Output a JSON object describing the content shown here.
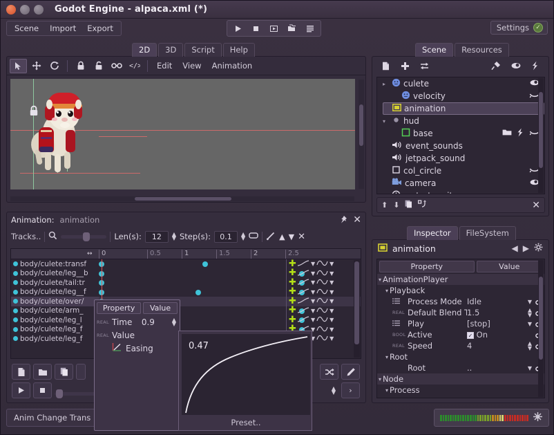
{
  "window": {
    "title": "Godot Engine - alpaca.xml (*)",
    "buttons": {
      "close": "×",
      "minimize": "–",
      "maximize": "□"
    }
  },
  "mainmenu": {
    "items": [
      "Scene",
      "Import",
      "Export"
    ]
  },
  "playbar": {
    "icons": [
      "play-icon",
      "stop-icon",
      "play-scene-icon",
      "play-custom-scene-icon",
      "list-icon"
    ]
  },
  "settings": {
    "label": "Settings",
    "badge": "✓"
  },
  "main_tabs": {
    "items": [
      "2D",
      "3D",
      "Script",
      "Help"
    ],
    "active": "2D"
  },
  "viewport_toolbar": {
    "tools": [
      "select-icon",
      "move-icon",
      "rotate-icon",
      "lock-icon",
      "unlock-icon",
      "group-icon",
      "ungroup-icon"
    ],
    "menus": [
      "Edit",
      "View",
      "Animation"
    ]
  },
  "viewport": {
    "lock_icon": "lock-icon"
  },
  "animation_panel": {
    "title_label": "Animation:",
    "animation_name": "animation",
    "tracks_label": "Tracks..",
    "len_label": "Len(s):",
    "len_value": "12",
    "step_label": "Step(s):",
    "step_value": "0.1",
    "ruler_ticks": [
      "0",
      "0.5",
      "1",
      "1.5",
      "2",
      "2.5"
    ],
    "tracks": [
      {
        "name": "body/culete:transf",
        "keys": [
          0.0,
          1.5
        ],
        "selected": false
      },
      {
        "name": "body/culete/leg__b",
        "keys": [
          0.0,
          2.9
        ],
        "selected": false
      },
      {
        "name": "body/culete/tail:tr",
        "keys": [
          0.0,
          2.9
        ],
        "selected": false
      },
      {
        "name": "body/culete/leg__f",
        "keys": [
          0.0,
          1.4,
          2.9
        ],
        "selected": false
      },
      {
        "name": "body/culete/over/",
        "keys": [
          0.0,
          2.9
        ],
        "selected": true
      },
      {
        "name": "body/culete/arm_",
        "keys": [
          0.0,
          2.9
        ],
        "selected": false
      },
      {
        "name": "body/culete/leg_l",
        "keys": [
          0.0,
          2.9
        ],
        "selected": false
      },
      {
        "name": "body/culete/leg_f",
        "keys": [
          0.0,
          2.9
        ],
        "selected": false
      },
      {
        "name": "body/culete/leg_f",
        "keys": [
          0.0,
          2.9
        ],
        "selected": false
      }
    ],
    "bottom_tools": [
      "new-animation-icon",
      "open-animation-icon",
      "duplicate-animation-icon",
      "more-icon"
    ],
    "transport": [
      "play-icon",
      "stop-icon"
    ],
    "right_tools": [
      "shuffle-icon",
      "edit-icon",
      "next-icon"
    ]
  },
  "key_popup": {
    "header": {
      "property": "Property",
      "value": "Value"
    },
    "rows": [
      {
        "type": "REAL",
        "name": "Time",
        "value": "0.9",
        "icon": "spinner-icon"
      },
      {
        "type": "REAL",
        "name": "Value",
        "value": "",
        "icon": ""
      },
      {
        "type": "",
        "name": "Easing",
        "value": "",
        "icon": "curve-icon"
      }
    ]
  },
  "easing_popup": {
    "value": "0.47",
    "preset_label": "Preset.."
  },
  "scene_dock": {
    "tabs": [
      "Scene",
      "Resources"
    ],
    "active_tab": "Scene",
    "toolbar": [
      "new-node-icon",
      "add-node-icon",
      "replace-node-icon",
      "connect-icon",
      "visibility-icon",
      "script-icon"
    ],
    "nodes": [
      {
        "label": "culete",
        "icon": "node2d-icon",
        "depth": 1,
        "arrow": "▸",
        "status": "eye-open-icon",
        "selected": false,
        "extra": []
      },
      {
        "label": "velocity",
        "icon": "node2d-icon",
        "depth": 2,
        "arrow": "",
        "status": "eye-closed-icon",
        "selected": false,
        "extra": []
      },
      {
        "label": "animation",
        "icon": "anim-icon",
        "depth": 1,
        "arrow": "",
        "status": "",
        "selected": true,
        "extra": []
      },
      {
        "label": "hud",
        "icon": "node-icon",
        "depth": 1,
        "arrow": "▾",
        "status": "",
        "selected": false,
        "extra": []
      },
      {
        "label": "base",
        "icon": "control-icon",
        "depth": 2,
        "arrow": "",
        "status": "eye-closed-icon",
        "selected": false,
        "extra": [
          "folder-icon",
          "script-icon"
        ]
      },
      {
        "label": "event_sounds",
        "icon": "sound-icon",
        "depth": 1,
        "arrow": "",
        "status": "",
        "selected": false,
        "extra": []
      },
      {
        "label": "jetpack_sound",
        "icon": "sound-icon",
        "depth": 1,
        "arrow": "",
        "status": "",
        "selected": false,
        "extra": []
      },
      {
        "label": "col_circle",
        "icon": "shape-icon",
        "depth": 1,
        "arrow": "",
        "status": "eye-closed-icon",
        "selected": false,
        "extra": []
      },
      {
        "label": "camera",
        "icon": "camera-icon",
        "depth": 1,
        "arrow": "",
        "status": "eye-open-icon",
        "selected": false,
        "extra": []
      },
      {
        "label": "restart_wait",
        "icon": "timer-icon",
        "depth": 1,
        "arrow": "",
        "status": "",
        "selected": false,
        "extra": []
      }
    ],
    "bottom_tools": [
      "move-up-icon",
      "move-down-icon",
      "duplicate-icon",
      "reparent-icon",
      "close-icon"
    ]
  },
  "inspector": {
    "tabs": [
      "Inspector",
      "FileSystem"
    ],
    "active_tab": "Inspector",
    "object_name": "animation",
    "object_icon": "anim-icon",
    "nav": [
      "back-icon",
      "forward-icon",
      "gear-icon"
    ],
    "columns": {
      "property": "Property",
      "value": "Value"
    },
    "rows": [
      {
        "kind": "category",
        "type": "",
        "name": "AnimationPlayer",
        "value": "",
        "depth": 0,
        "arrow": "▾",
        "icon": "",
        "key": false
      },
      {
        "kind": "group",
        "type": "",
        "name": "Playback",
        "value": "",
        "depth": 1,
        "arrow": "▾",
        "icon": "",
        "key": false
      },
      {
        "kind": "prop",
        "type": "",
        "name": "Process Mode",
        "value": "Idle",
        "depth": 2,
        "arrow": "",
        "icon": "enum-icon",
        "key": true,
        "ctrl": "dropdown"
      },
      {
        "kind": "prop",
        "type": "REAL",
        "name": "Default Blend Ti",
        "value": "1.5",
        "depth": 2,
        "arrow": "",
        "icon": "",
        "key": true,
        "ctrl": "spinner"
      },
      {
        "kind": "prop",
        "type": "",
        "name": "Play",
        "value": "[stop]",
        "depth": 2,
        "arrow": "",
        "icon": "enum-icon",
        "key": true,
        "ctrl": "dropdown"
      },
      {
        "kind": "prop",
        "type": "BOOL",
        "name": "Active",
        "value": "On",
        "depth": 2,
        "arrow": "",
        "icon": "",
        "key": true,
        "ctrl": "checkbox"
      },
      {
        "kind": "prop",
        "type": "REAL",
        "name": "Speed",
        "value": "4",
        "depth": 2,
        "arrow": "",
        "icon": "",
        "key": true,
        "ctrl": "spinner"
      },
      {
        "kind": "group",
        "type": "",
        "name": "Root",
        "value": "",
        "depth": 1,
        "arrow": "▾",
        "icon": "",
        "key": false
      },
      {
        "kind": "prop",
        "type": "",
        "name": "Root",
        "value": "..",
        "depth": 2,
        "arrow": "",
        "icon": "",
        "key": true,
        "ctrl": "dropdown"
      },
      {
        "kind": "category",
        "type": "",
        "name": "Node",
        "value": "",
        "depth": 0,
        "arrow": "▾",
        "icon": "",
        "key": false
      },
      {
        "kind": "group",
        "type": "",
        "name": "Process",
        "value": "",
        "depth": 1,
        "arrow": "▾",
        "icon": "",
        "key": false
      }
    ]
  },
  "status_bar": {
    "message": "Anim Change Trans",
    "fx_icon": "light-icon"
  },
  "colors": {
    "accent": "#b4e017",
    "key": "#3fc3d8",
    "playhead": "#e05a5a",
    "selection": "#4c4157",
    "panel": "#362e3e",
    "background": "#2b2430"
  }
}
